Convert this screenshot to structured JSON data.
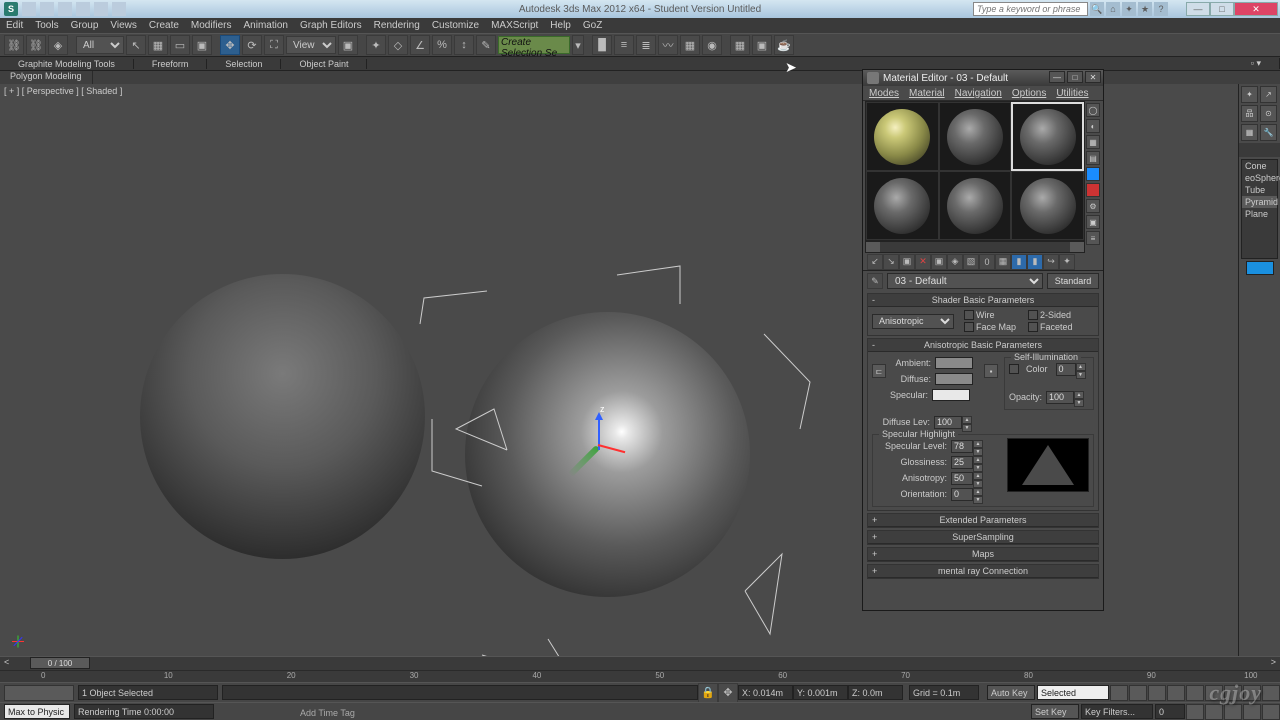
{
  "app": {
    "title": "Autodesk 3ds Max 2012 x64 - Student Version   Untitled",
    "search_placeholder": "Type a keyword or phrase"
  },
  "menus": [
    "Edit",
    "Tools",
    "Group",
    "Views",
    "Create",
    "Modifiers",
    "Animation",
    "Graph Editors",
    "Rendering",
    "Customize",
    "MAXScript",
    "Help",
    "GoZ"
  ],
  "toolbar": {
    "ref_sys": "View",
    "filter_text": "Create Selection Se"
  },
  "ribbon": {
    "tabs": [
      "Graphite Modeling Tools",
      "Freeform",
      "Selection",
      "Object Paint"
    ],
    "sub": "Polygon Modeling"
  },
  "viewport": {
    "label": "[ + ] [ Perspective ] [ Shaded ]",
    "gizmo_z": "z"
  },
  "mat": {
    "title": "Material Editor - 03 - Default",
    "menus": [
      "Modes",
      "Material",
      "Navigation",
      "Options",
      "Utilities"
    ],
    "name_current": "03 - Default",
    "type_button": "Standard",
    "rollouts": {
      "shader_basic": "Shader Basic Parameters",
      "aniso_basic": "Anisotropic Basic Parameters",
      "extended": "Extended Parameters",
      "supersampling": "SuperSampling",
      "maps": "Maps",
      "mental": "mental ray Connection"
    },
    "shader": {
      "type": "Anisotropic",
      "wire": "Wire",
      "twosided": "2-Sided",
      "facemap": "Face Map",
      "faceted": "Faceted"
    },
    "params": {
      "ambient": "Ambient:",
      "diffuse": "Diffuse:",
      "specular": "Specular:",
      "self_illum": "Self-Illumination",
      "color": "Color",
      "color_val": "0",
      "opacity": "Opacity:",
      "opacity_val": "100",
      "diffuse_lev": "Diffuse Lev:",
      "diffuse_lev_val": "100",
      "spec_hl": "Specular Highlight",
      "spec_level": "Specular Level:",
      "spec_level_val": "78",
      "gloss": "Glossiness:",
      "gloss_val": "25",
      "aniso": "Anisotropy:",
      "aniso_val": "50",
      "orient": "Orientation:",
      "orient_val": "0"
    }
  },
  "cmd_panel": {
    "primitives": [
      "Cone",
      "eoSphere",
      "Tube",
      "Pyramid",
      "Plane"
    ]
  },
  "timeline": {
    "pos": "0 / 100",
    "ticks": [
      "0",
      "10",
      "20",
      "30",
      "40",
      "50",
      "60",
      "70",
      "80",
      "90",
      "100"
    ]
  },
  "transport": {
    "selected": "1 Object Selected",
    "x": "X: 0.014m",
    "y": "Y: 0.001m",
    "z": "Z: 0.0m",
    "grid": "Grid = 0.1m",
    "autokey": "Auto Key",
    "setkey": "Set Key",
    "selected_btn": "Selected",
    "keyfilters": "Key Filters..."
  },
  "statusbar": {
    "script": "Max to Physic",
    "timestatus": "Rendering Time 0:00:00",
    "timetag": "Add Time Tag"
  },
  "watermark": "cgjoy"
}
